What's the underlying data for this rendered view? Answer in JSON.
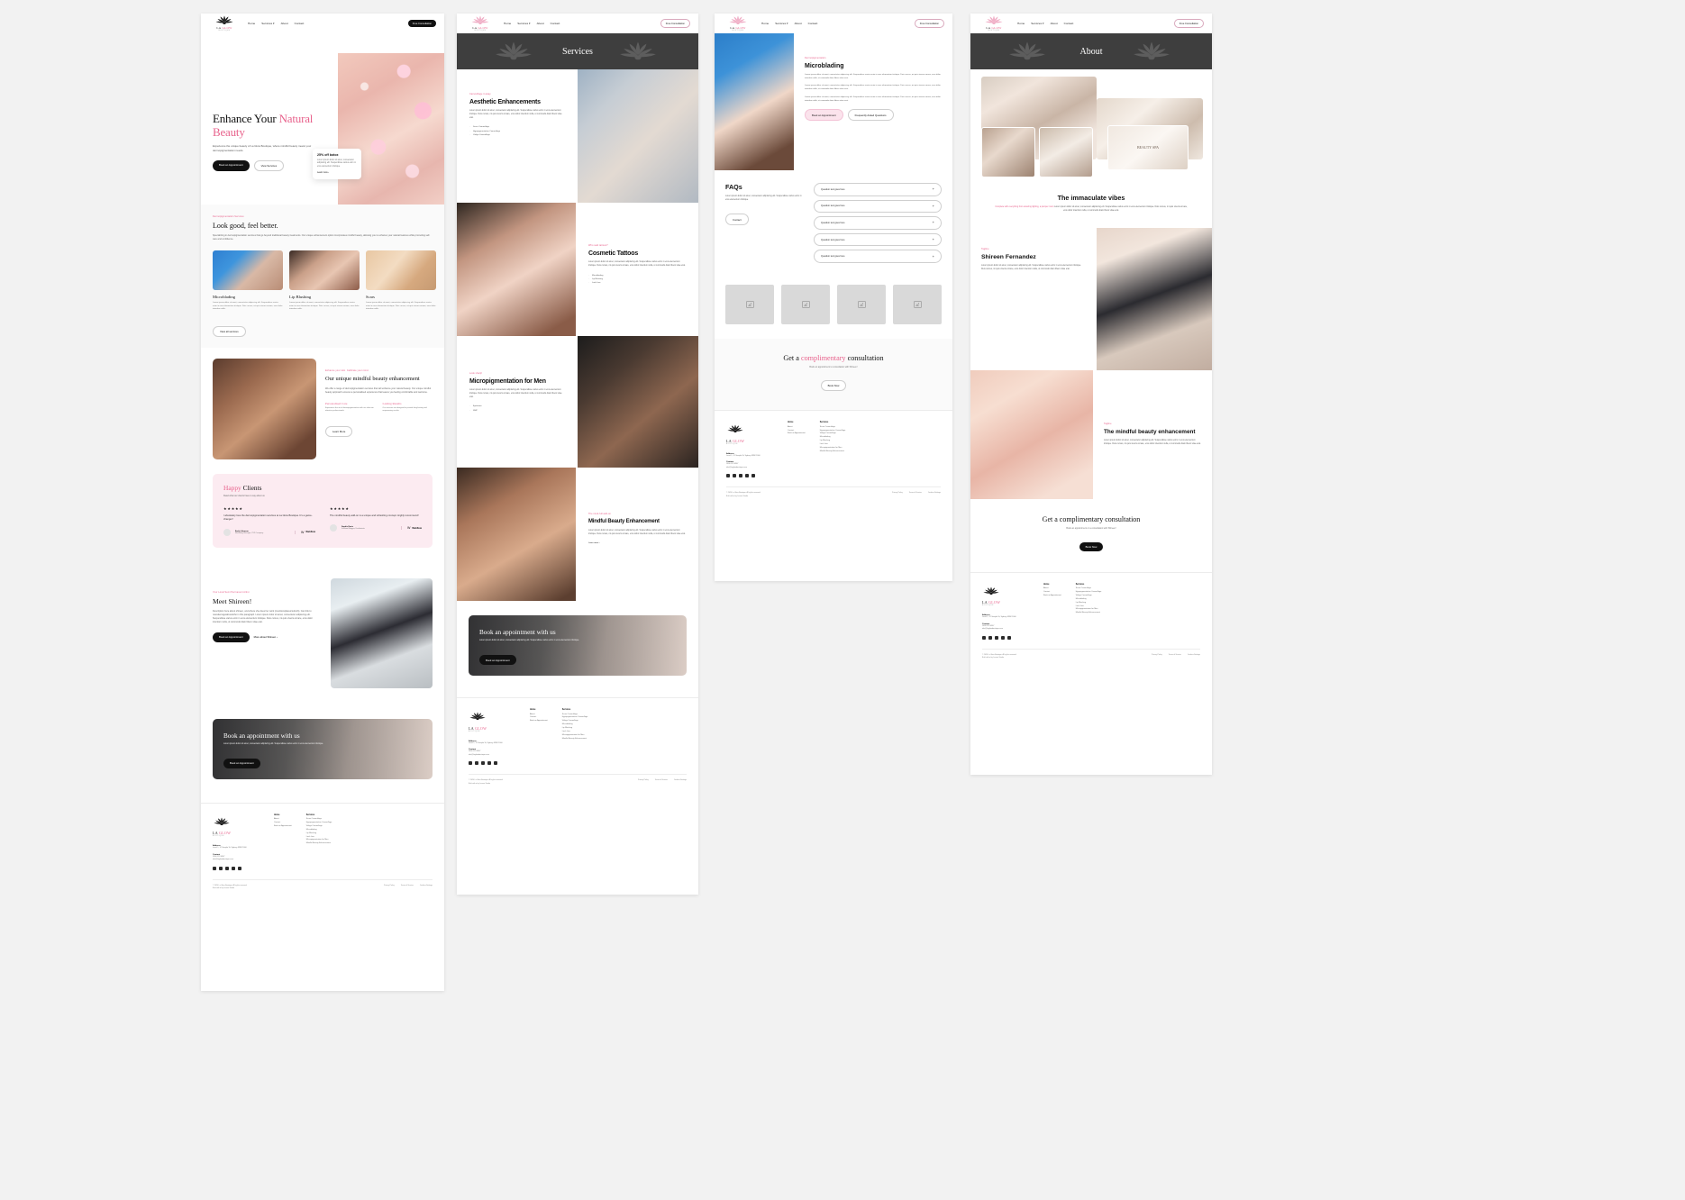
{
  "brand": {
    "name_line1": "LA GLOW",
    "name_line2": "BOUTIQUE",
    "logo_icon": "lotus-icon"
  },
  "nav": {
    "links": [
      "Home",
      "Services",
      "About",
      "Contact"
    ],
    "services_caret": "chevron-down-icon",
    "cta_dark": "Free Consultation",
    "cta_outline": "Free Consultation"
  },
  "page1": {
    "hero": {
      "title_part1": "Enhance Your ",
      "title_accent": "Natural",
      "title_part2": "Beauty",
      "subtitle": "Experience the unique beauty of La Glow Boutique, where mindful beauty meets your dermopigmentation needs.",
      "primary_button": "Book an Appointment",
      "secondary_button": "View Services",
      "image_alt": "cherry-blossom-spa-image"
    },
    "promo": {
      "title": "25% off botox",
      "body": "Lorem ipsum dolor sit amet, consectetur adipiscing elit. Suspendisse varius enim in eros elementum tristique.",
      "link": "Learn more"
    },
    "services": {
      "eyebrow": "Dermopigmentation Services",
      "heading": "Look good, feel better.",
      "body": "Specializing in dermopigmentation services that go beyond traditional beauty treatments. Our unique enhancement option incorporates mindful beauty, allowing you to enhance your natural features while promoting self-care and confidence.",
      "cards": [
        {
          "title": "Microblading",
          "body": "Lorem ipsum dolor sit amet, consectetur adipiscing elit. Suspendisse varius enim in eros elementum tristique. Duis cursus, mi quis viverra ornare, eros dolor interdum nulla.",
          "image": "microblading-image"
        },
        {
          "title": "Lip Blushing",
          "body": "Lorem ipsum dolor sit amet, consectetur adipiscing elit. Suspendisse varius enim in eros elementum tristique. Duis cursus, mi quis viverra ornare, eros dolor interdum nulla.",
          "image": "lip-blushing-image"
        },
        {
          "title": "Scars",
          "body": "Lorem ipsum dolor sit amet, consectetur adipiscing elit. Suspendisse varius enim in eros elementum tristique. Duis cursus, mi quis viverra ornare, eros dolor interdum nulla.",
          "image": "scars-image"
        }
      ],
      "all_button": "View all services"
    },
    "unique": {
      "eyebrow": "Enhance your skin. Calibrate your mind.",
      "heading": "Our unique mindful beauty enhancement",
      "body": "We offer a range of dermopigmentation services that will enhance your natural beauty. Our unique mindful beauty approach ensures a personalised experience that leaves you feeling comfortable and welcome.",
      "sub1_title": "Personalised Care",
      "sub1_body": "Experience the art of dermopigmentation with our skincare attentive professionals.",
      "sub2_title": "Lasting Results",
      "sub2_body": "Our services are designed to provide long-lasting and empowering results.",
      "button": "Learn More",
      "image_alt": "facial-massage-image"
    },
    "testimonials": {
      "heading_accent": "Happy",
      "heading_rest": " Clients",
      "subtitle": "Read what our clients have to say about us",
      "items": [
        {
          "stars": "★★★★★",
          "quote": "I absolutely love the dermopigmentation services at La Glow Boutique. It's a game-changer!",
          "name": "Emily Johnson",
          "role": "Marketing Manager, XYZ Company",
          "brand": "Webflow"
        },
        {
          "stars": "★★★★★",
          "quote": "The mindful beauty add-on is a unique and refreshing concept. Highly recommend!",
          "name": "Sophie Davis",
          "role": "Fashion Blogger, Fashionista",
          "brand": "Webflow"
        }
      ]
    },
    "meet": {
      "eyebrow": "Your Local Semi Permanent Artist",
      "heading": "Meet Shireen!",
      "body": "Description here about shireen, and where she does her work (mentionsplaces/suburb). Can link to newsitemsgetabout/who in this paragraph. Lorem ipsum dolor sit amet, consectetur adipiscing elit. Suspendisse varius enim in eros elementum tristique. Duis cursus, mi quis viverra ornare, eros dolor interdum nulla, ut commodo diam libero vitae erat.",
      "button1": "Book an Appointment",
      "button2": "More about Shireen",
      "image_alt": "shireen-portrait-image"
    },
    "banner": {
      "heading": "Book an appointment with us",
      "body": "Lorem ipsum dolor sit amet, consectetur adipiscing elit. Suspendisse varius enim in eros elementum tristique.",
      "button": "Book an Appointment",
      "image_alt": "laser-treatment-image"
    }
  },
  "page2": {
    "header_title": "Services",
    "sections": [
      {
        "eyebrow": "Camouflage it away",
        "heading": "Aesthetic Enhancements",
        "body": "Lorem ipsum dolor sit amet, consectetur adipiscing elit. Suspendisse varius enim in eros elementum tristique. Duis cursus, mi quis viverra ornare, eros dolor interdum nulla, ut commodo diam libero vitae erat.",
        "list": [
          "Scars Camouflage",
          "Hypopigmentation Camouflage",
          "Vitiligo Camouflage"
        ],
        "image": "aesthetic-enhancements-image"
      },
      {
        "eyebrow": "Who said tattoos?",
        "heading": "Cosmetic Tattoos",
        "body": "Lorem ipsum dolor sit amet, consectetur adipiscing elit. Suspendisse varius enim in eros elementum tristique. Duis cursus, mi quis viverra ornare, eros dolor interdum nulla, ut commodo diam libero vitae erat.",
        "list": [
          "Microblading",
          "Lip Blushing",
          "Lash Line"
        ],
        "image": "cosmetic-tattoos-image"
      },
      {
        "eyebrow": "Look sharp!",
        "heading": "Micropigmentation for Men",
        "body": "Lorem ipsum dolor sit amet, consectetur adipiscing elit. Suspendisse varius enim in eros elementum tristique. Duis cursus, mi quis viverra ornare, eros dolor interdum nulla, ut commodo diam libero vitae erat.",
        "list": [
          "Eyebrows",
          "SMP"
        ],
        "image": "micropigmentation-men-image"
      },
      {
        "eyebrow": "The mind-full add-on",
        "heading": "Mindful Beauty Enhancement",
        "body": "Lorem ipsum dolor sit amet, consectetur adipiscing elit. Suspendisse varius enim in eros elementum tristique. Duis cursus, mi quis viverra ornare, eros dolor interdum nulla, ut commodo diam libero vitae erat.",
        "more_link": "Learn more",
        "image": "mindful-beauty-image"
      }
    ],
    "banner": {
      "heading": "Book an appointment with us",
      "body": "Lorem ipsum dolor sit amet, consectetur adipiscing elit. Suspendisse varius enim in eros elementum tristique.",
      "button": "Book an Appointment"
    }
  },
  "page3": {
    "detail": {
      "eyebrow": "Dermopigmentation",
      "heading": "Microblading",
      "p1": "Lorem ipsum dolor sit amet, consectetur adipiscing elit. Suspendisse varius enim in eros elementum tristique. Duis cursus, mi quis viverra ornare, eros dolor interdum nulla, ut commodo diam libero vitae erat.",
      "p2": "Lorem ipsum dolor sit amet, consectetur adipiscing elit. Suspendisse varius enim in eros elementum tristique. Duis cursus, mi quis viverra ornare, eros dolor interdum nulla, ut commodo diam libero vitae erat.",
      "p3": "Lorem ipsum dolor sit amet, consectetur adipiscing elit. Suspendisse varius enim in eros elementum tristique. Duis cursus, mi quis viverra ornare, eros dolor interdum nulla, ut commodo diam libero vitae erat.",
      "button1": "Book an Appointment",
      "button2": "Frequently Asked Questions",
      "image": "microblading-procedure-image"
    },
    "faqs": {
      "heading": "FAQs",
      "body": "Lorem ipsum dolor sit amet, consectetur adipiscing elit. Suspendisse varius enim in eros elementum tristique.",
      "button": "Contact",
      "items": [
        {
          "question": "Question text goes here",
          "toggle": "+"
        },
        {
          "question": "Question text goes here",
          "toggle": "+"
        },
        {
          "question": "Question text goes here",
          "toggle": "+"
        },
        {
          "question": "Question text goes here",
          "toggle": "+"
        },
        {
          "question": "Question text goes here",
          "toggle": "+"
        }
      ]
    },
    "gallery": {
      "placeholders": 4,
      "icon": "image-placeholder-icon"
    },
    "cta": {
      "heading_pre": "Get a ",
      "heading_accent": "complimentary",
      "heading_post": " consultation",
      "subtitle": "Book an appointment to consultation with Shireen!",
      "button": "Book Now"
    }
  },
  "page4": {
    "header_title": "About",
    "collage_badge": "BEAUTY SPA",
    "immaculate": {
      "heading": "The immaculate vibes",
      "link_text": "Complete with everything from amazing lighting, a pamper room",
      "body": "Lorem ipsum dolor sit amet, consectetur adipiscing elit. Suspendisse varius enim in eros elementum tristique. Duis cursus, mi quis viverra ornare, eros dolor interdum nulla, ut commodo diam libero vitae erat."
    },
    "shireen": {
      "eyebrow": "Tagline",
      "heading": "Shireen Fernandez",
      "body": "Lorem ipsum dolor sit amet, consectetur adipiscing elit. Suspendisse varius enim in eros elementum tristique. Duis cursus, mi quis viverra ornare, eros dolor interdum nulla, ut commodo diam libero vitae erat.",
      "image": "shireen-portrait-image"
    },
    "mindful": {
      "eyebrow": "Tagline",
      "heading": "The mindful beauty enhancement",
      "body": "Lorem ipsum dolor sit amet, consectetur adipiscing elit. Suspendisse varius enim in eros elementum tristique. Duis cursus, mi quis viverra ornare, eros dolor interdum nulla, ut commodo diam libero vitae erat.",
      "image": "mindful-facial-image"
    },
    "cta": {
      "heading": "Get a complimentary consultation",
      "subtitle": "Book an appointment or a consultation with Shireen!",
      "button": "Book Now"
    }
  },
  "footer": {
    "col1_title": "Home",
    "col1_links": [
      "Home",
      "About",
      "Contact",
      "Book an Appointment"
    ],
    "col2_title": "Services",
    "col2_links": [
      "Scars Camouflage",
      "Hypopigmentation Camouflage",
      "Vitiligo Camouflage",
      "Microblading",
      "Lip Blushing",
      "Lash Line",
      "Micropigmentation for Men",
      "Mindful Beauty Enhancement"
    ],
    "address_title": "Address",
    "address_lines": [
      "Level 1, 12 Sample St, Sydney NSW 2000"
    ],
    "contact_title": "Contact",
    "contact_lines": [
      "1800 123 4567",
      "info@laglowboutique.com"
    ],
    "socials": [
      "facebook-icon",
      "instagram-icon",
      "x-icon",
      "linkedin-icon",
      "youtube-icon"
    ],
    "copyright": "© 2024 La Glow Boutique. All rights reserved.",
    "credit": "Built with ♥ by Lenore Studio",
    "legal": [
      "Privacy Policy",
      "Terms of Service",
      "Cookies Settings"
    ]
  },
  "colors": {
    "accent_pink": "#e8628c",
    "soft_pink": "#fcebf1",
    "dark": "#111111",
    "band_grey": "#3e3e3e"
  }
}
